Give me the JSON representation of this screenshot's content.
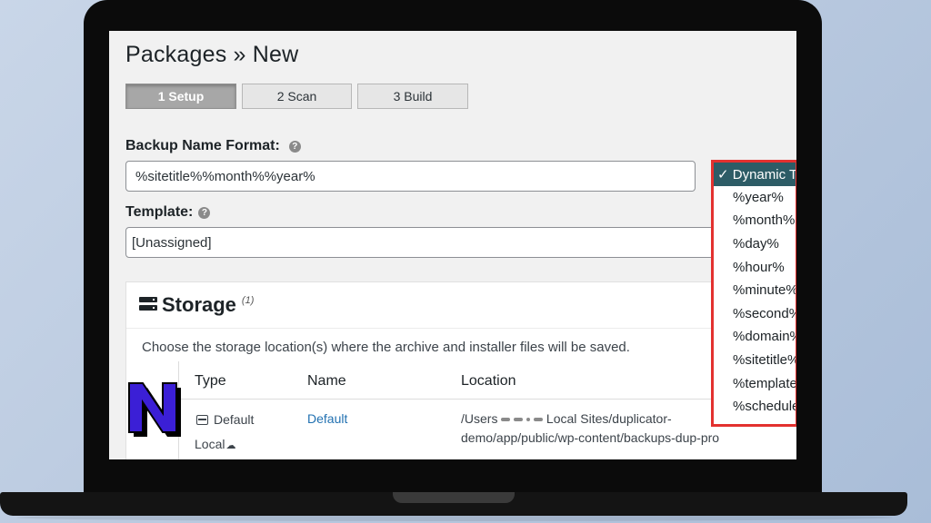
{
  "page": {
    "title": "Packages » New"
  },
  "steps": [
    {
      "label": "1 Setup",
      "active": true
    },
    {
      "label": "2 Scan",
      "active": false
    },
    {
      "label": "3 Build",
      "active": false
    }
  ],
  "backup_name": {
    "label": "Backup Name Format:",
    "value": "%sitetitle%%month%%year%"
  },
  "template": {
    "label": "Template:",
    "value": "[Unassigned]"
  },
  "storage": {
    "title": "Storage",
    "count": "(1)",
    "description": "Choose the storage location(s) where the archive and installer files will be saved.",
    "columns": {
      "type": "Type",
      "name": "Name",
      "location": "Location"
    },
    "row": {
      "type_line1": "Default",
      "type_line2": "Local",
      "name": "Default",
      "location_prefix": "/Users",
      "location_line1_rest": "Local Sites/duplicator-",
      "location_line2": "demo/app/public/wp-content/backups-dup-pro"
    }
  },
  "dropdown": {
    "items": [
      "✓ Dynamic T",
      "%year%",
      "%month%",
      "%day%",
      "%hour%",
      "%minute%",
      "%second%",
      "%domain%",
      "%sitetitle%",
      "%template%",
      "%schedule"
    ]
  },
  "colors": {
    "highlight_border": "#e3312f",
    "selected_option_bg": "#2d5c66",
    "link": "#2271b1",
    "logo_fill": "#3b1fd6"
  }
}
